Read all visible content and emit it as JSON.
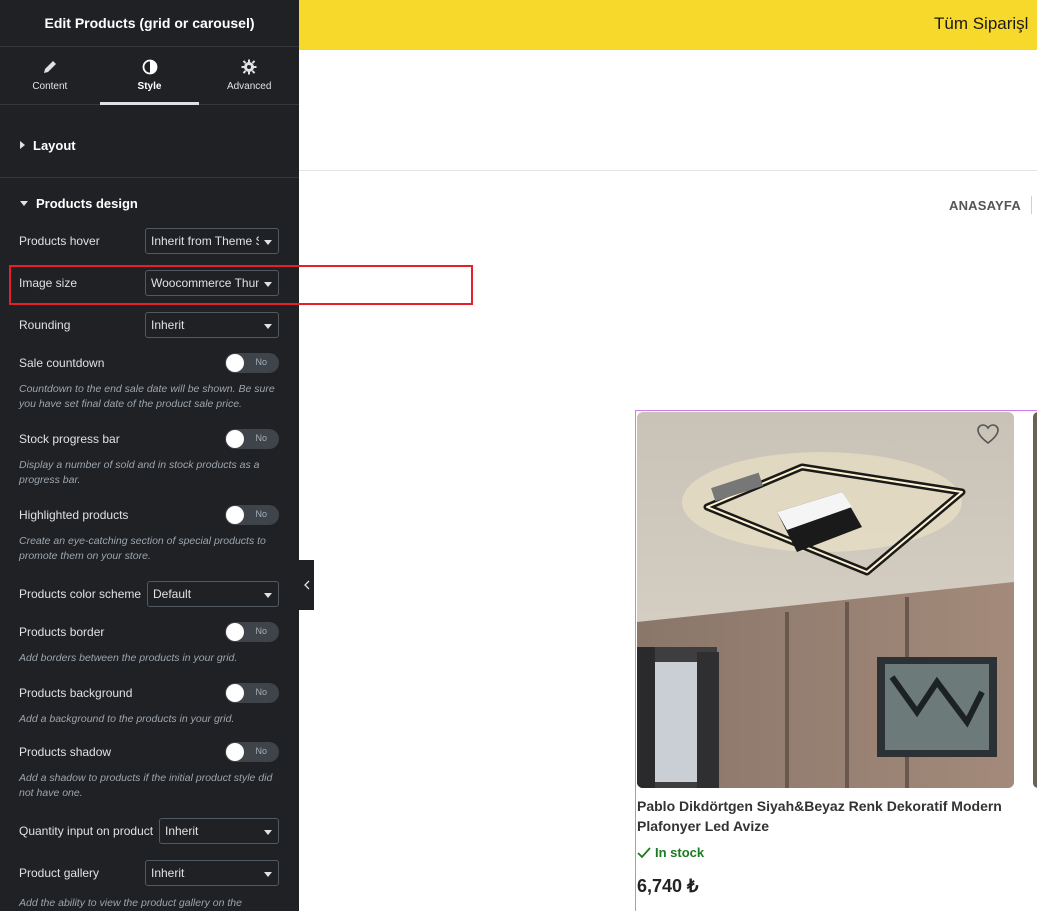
{
  "panel": {
    "title": "Edit Products (grid or carousel)",
    "tabs": [
      {
        "label": "Content",
        "icon": "pencil-icon"
      },
      {
        "label": "Style",
        "icon": "contrast-icon"
      },
      {
        "label": "Advanced",
        "icon": "gear-icon"
      }
    ],
    "active_tab": "Style",
    "sections": {
      "layout": "Layout",
      "products_design": "Products design"
    },
    "controls": {
      "products_hover": {
        "label": "Products hover",
        "value": "Inherit from Theme Settings"
      },
      "image_size": {
        "label": "Image size",
        "value": "Woocommerce Thumbnail"
      },
      "rounding": {
        "label": "Rounding",
        "value": "Inherit"
      },
      "sale_countdown": {
        "label": "Sale countdown",
        "toggle": "No",
        "desc": "Countdown to the end sale date will be shown. Be sure you have set final date of the product sale price."
      },
      "stock_progress_bar": {
        "label": "Stock progress bar",
        "toggle": "No",
        "desc": "Display a number of sold and in stock products as a progress bar."
      },
      "highlighted_products": {
        "label": "Highlighted products",
        "toggle": "No",
        "desc": "Create an eye-catching section of special products to promote them on your store."
      },
      "products_color_scheme": {
        "label": "Products color scheme",
        "value": "Default"
      },
      "products_border": {
        "label": "Products border",
        "toggle": "No",
        "desc": "Add borders between the products in your grid."
      },
      "products_background": {
        "label": "Products background",
        "toggle": "No",
        "desc": "Add a background to the products in your grid."
      },
      "products_shadow": {
        "label": "Products shadow",
        "toggle": "No",
        "desc": "Add a shadow to products if the initial product style did not have one."
      },
      "quantity_input": {
        "label": "Quantity input on product",
        "value": "Inherit"
      },
      "product_gallery": {
        "label": "Product gallery",
        "value": "Inherit",
        "desc": "Add the ability to view the product gallery on the"
      }
    }
  },
  "site": {
    "topbar_text": "Tüm Siparişl",
    "nav_home": "ANASAYFA",
    "colors": {
      "topbar": "#f7d92c",
      "highlight": "#e5202a",
      "outline": "#d27bf0",
      "stock": "#1c7a23"
    }
  },
  "product": {
    "title": "Pablo Dikdörtgen Siyah&Beyaz Renk Dekoratif Modern Plafonyer Led Avize",
    "stock": "In stock",
    "price": "6,740 ₺",
    "wishlist_icon": "heart-icon"
  }
}
